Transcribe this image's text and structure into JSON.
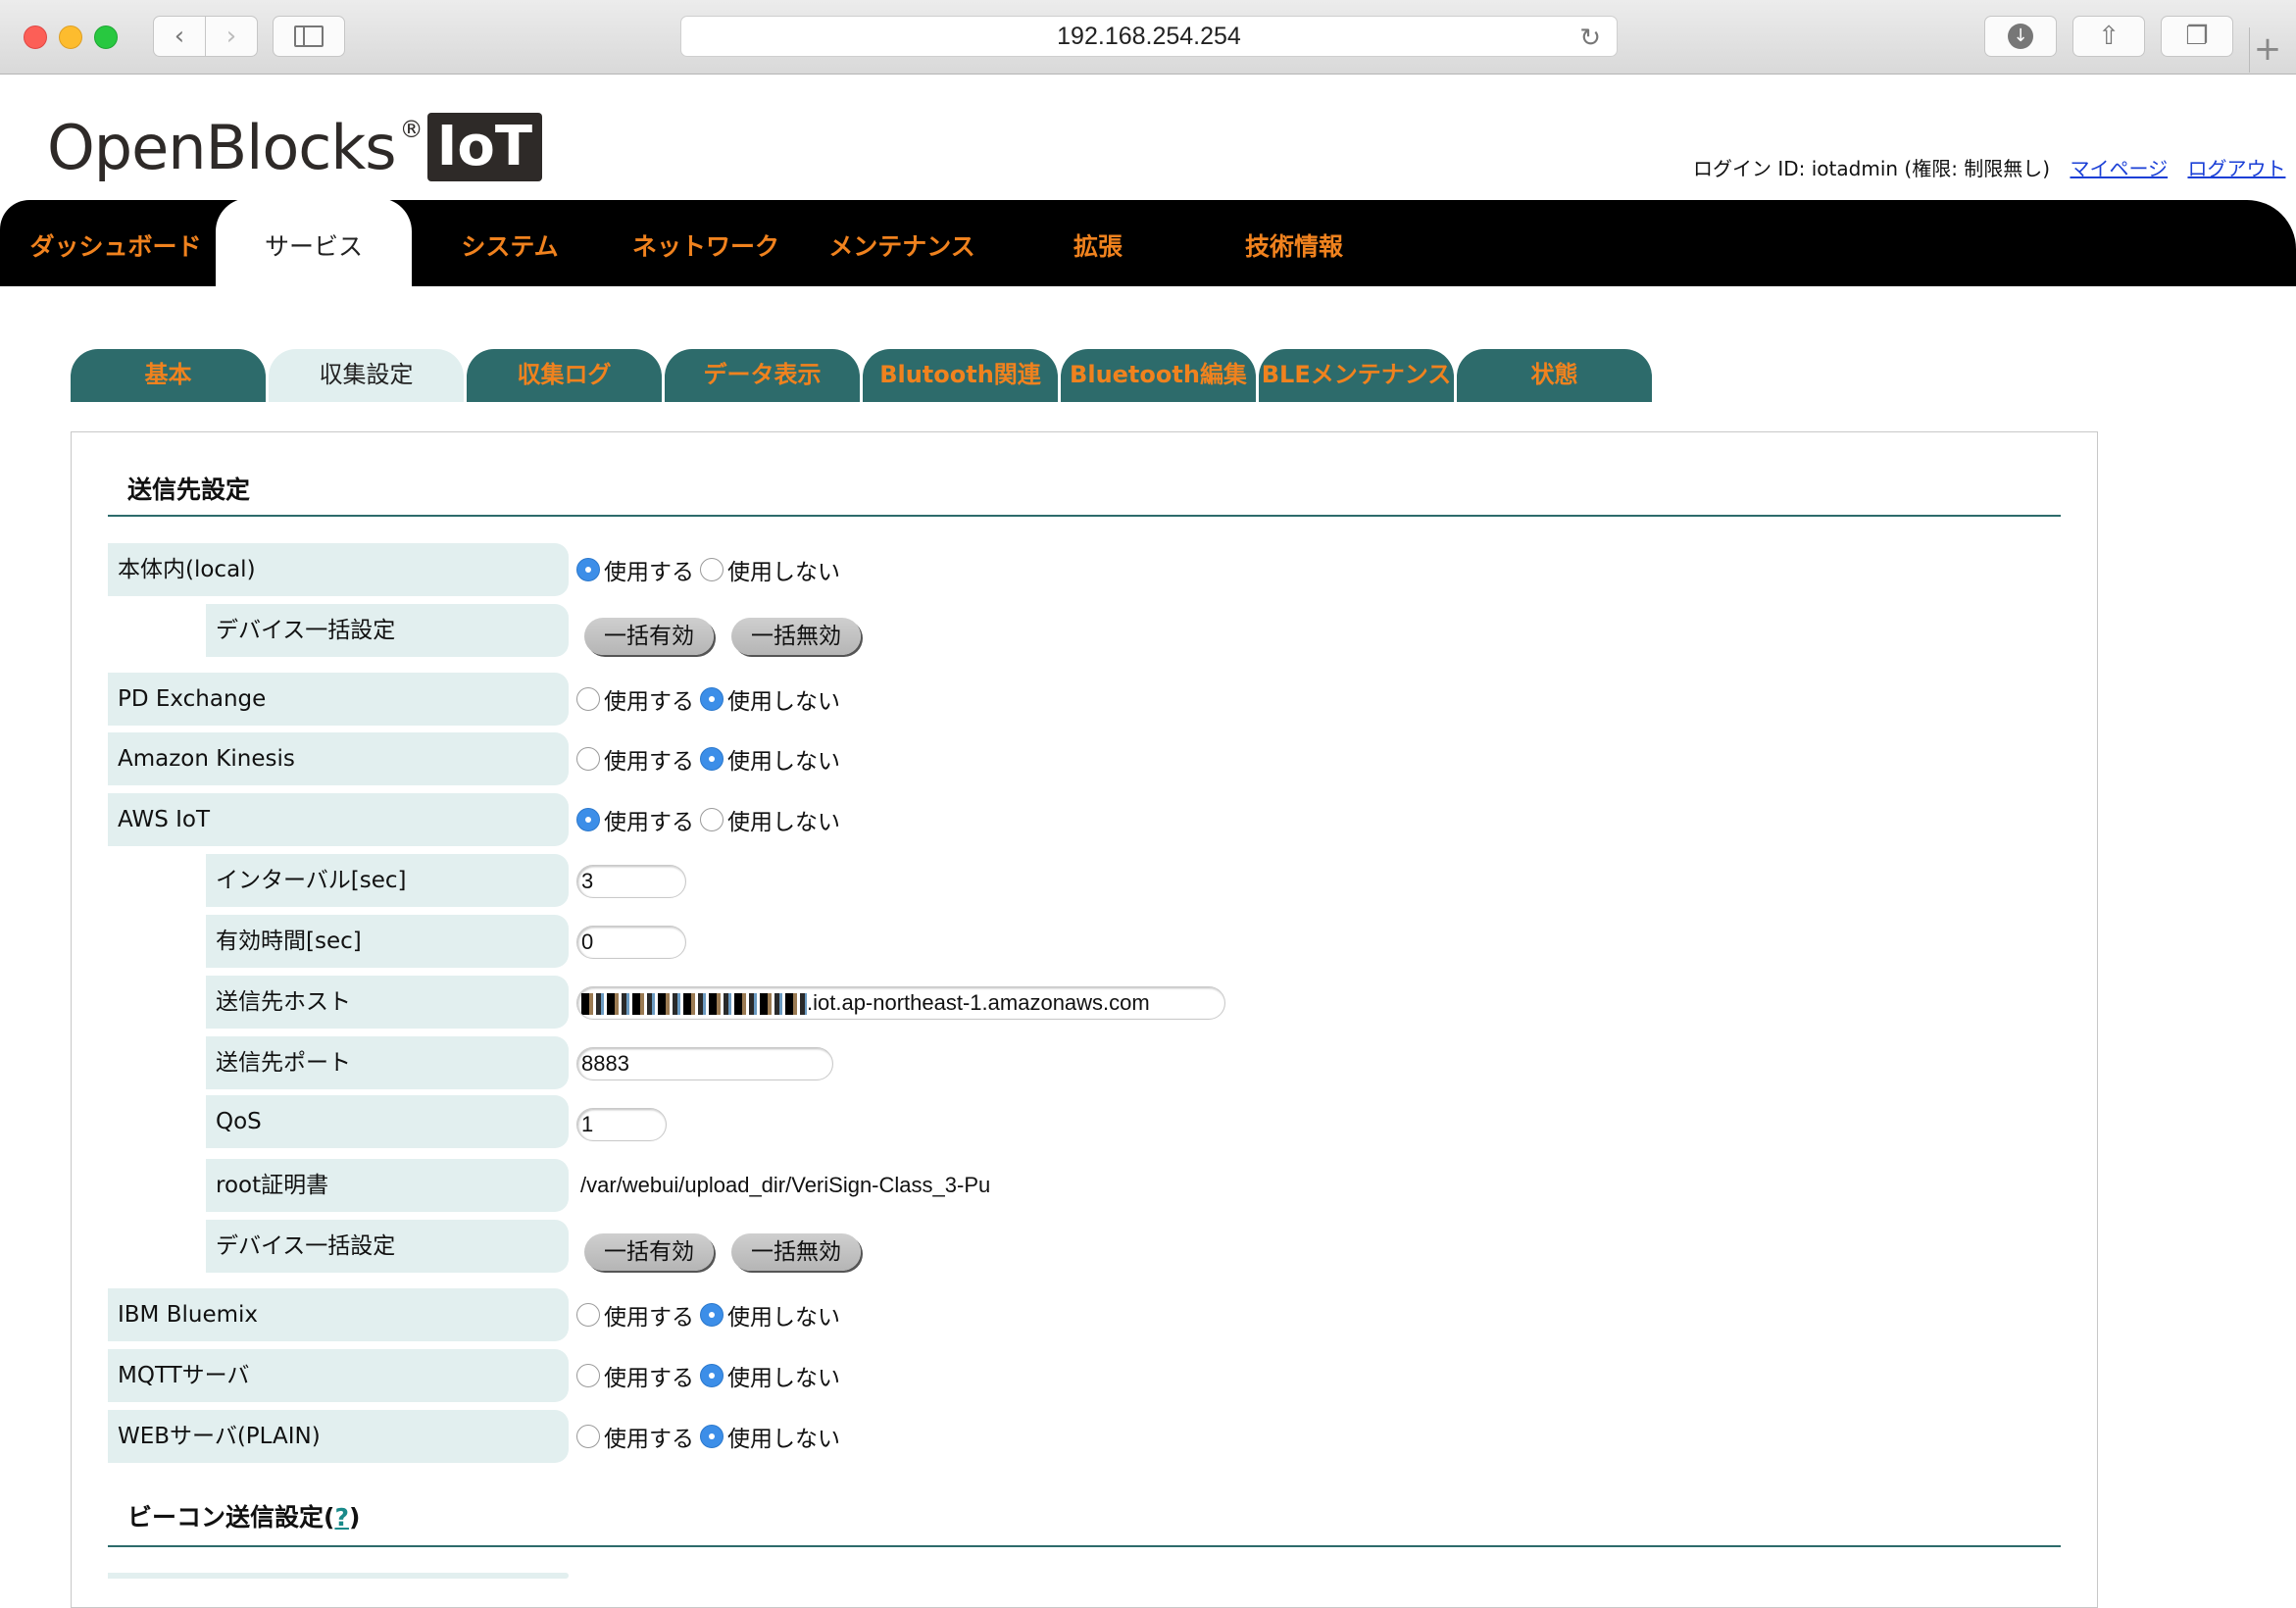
{
  "browser": {
    "url": "192.168.254.254"
  },
  "header": {
    "logo_text": "OpenBlocks",
    "logo_mark": "®",
    "logo_badge": "IoT",
    "login_info": "ログイン ID: iotadmin (権限: 制限無し)",
    "mypage_link": "マイページ",
    "logout_link": "ログアウト"
  },
  "main_nav": [
    "ダッシュボード",
    "サービス",
    "システム",
    "ネットワーク",
    "メンテナンス",
    "拡張",
    "技術情報"
  ],
  "main_nav_active": "サービス",
  "sub_tabs": [
    "基本",
    "収集設定",
    "収集ログ",
    "データ表示",
    "Blutooth関連",
    "Bluetooth編集",
    "BLEメンテナンス",
    "状態"
  ],
  "sub_tab_active": "収集設定",
  "section1": {
    "title": "送信先設定"
  },
  "radio_labels": {
    "use": "使用する",
    "not_use": "使用しない"
  },
  "bulk_buttons": {
    "enable": "一括有効",
    "disable": "一括無効"
  },
  "rows": {
    "local": {
      "label": "本体内(local)",
      "selected": "use"
    },
    "local_bulk": {
      "label": "デバイス一括設定"
    },
    "pd_exchange": {
      "label": "PD Exchange",
      "selected": "not_use"
    },
    "kinesis": {
      "label": "Amazon Kinesis",
      "selected": "not_use"
    },
    "aws_iot": {
      "label": "AWS IoT",
      "selected": "use"
    },
    "interval": {
      "label": "インターバル[sec]",
      "value": "3"
    },
    "valid_time": {
      "label": "有効時間[sec]",
      "value": "0"
    },
    "host": {
      "label": "送信先ホスト",
      "value": ".iot.ap-northeast-1.amazonaws.com"
    },
    "port": {
      "label": "送信先ポート",
      "value": "8883"
    },
    "qos": {
      "label": "QoS",
      "value": "1"
    },
    "root_cert": {
      "label": "root証明書",
      "value": "/var/webui/upload_dir/VeriSign-Class_3-Pu"
    },
    "aws_bulk": {
      "label": "デバイス一括設定"
    },
    "bluemix": {
      "label": "IBM Bluemix",
      "selected": "not_use"
    },
    "mqtt": {
      "label": "MQTTサーバ",
      "selected": "not_use"
    },
    "web_plain": {
      "label": "WEBサーバ(PLAIN)",
      "selected": "not_use"
    }
  },
  "section2": {
    "title": "ビーコン送信設定(",
    "help": "?",
    "close": ")"
  },
  "colors": {
    "accent": "#f0821e",
    "teal": "#2d6b6b",
    "label_bg": "#e2efef",
    "nav_bg": "#000000"
  }
}
